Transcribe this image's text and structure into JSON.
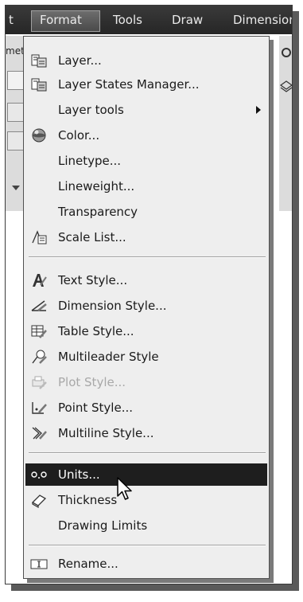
{
  "menubar": {
    "items": [
      {
        "label": "t"
      },
      {
        "label": "Format"
      },
      {
        "label": "Tools"
      },
      {
        "label": "Draw"
      },
      {
        "label": "Dimension"
      }
    ],
    "active": "Format"
  },
  "toolstrip": {
    "label": "met"
  },
  "menu": {
    "items": [
      {
        "label": "Layer...",
        "icon": "layer-icon"
      },
      {
        "label": "Layer States Manager...",
        "icon": "layer-states-icon"
      },
      {
        "label": "Layer tools",
        "icon": "",
        "submenu": true
      },
      {
        "label": "Color...",
        "icon": "color-sphere-icon"
      },
      {
        "label": "Linetype...",
        "icon": ""
      },
      {
        "label": "Lineweight...",
        "icon": ""
      },
      {
        "label": "Transparency",
        "icon": ""
      },
      {
        "label": "Scale List...",
        "icon": "scale-list-icon"
      },
      {
        "label": "Text Style...",
        "icon": "text-style-icon"
      },
      {
        "label": "Dimension Style...",
        "icon": "dimension-style-icon"
      },
      {
        "label": "Table Style...",
        "icon": "table-style-icon"
      },
      {
        "label": "Multileader Style",
        "icon": "multileader-style-icon"
      },
      {
        "label": "Plot Style...",
        "icon": "plot-style-icon",
        "disabled": true
      },
      {
        "label": "Point Style...",
        "icon": "point-style-icon"
      },
      {
        "label": "Multiline Style...",
        "icon": "multiline-style-icon"
      },
      {
        "label": "Units...",
        "icon": "units-icon",
        "highlighted": true
      },
      {
        "label": "Thickness",
        "icon": "thickness-icon"
      },
      {
        "label": "Drawing Limits",
        "icon": ""
      },
      {
        "label": "Rename...",
        "icon": "rename-icon"
      }
    ]
  }
}
